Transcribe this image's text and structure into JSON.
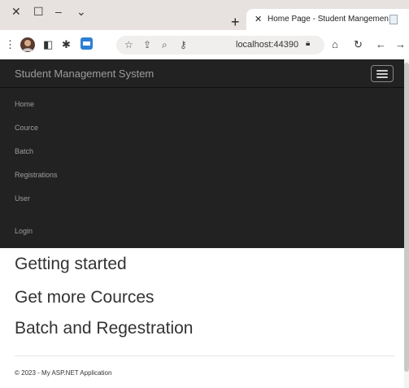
{
  "browser": {
    "tab": {
      "title": "Home Page - Student Mangemen"
    },
    "address": {
      "url": "localhost:44390"
    }
  },
  "navbar": {
    "brand": "Student Management System",
    "items": [
      {
        "label": "Home"
      },
      {
        "label": "Cource"
      },
      {
        "label": "Batch"
      },
      {
        "label": "Registrations"
      },
      {
        "label": "User"
      },
      {
        "label": "Login"
      }
    ]
  },
  "main": {
    "headings": [
      "Getting started",
      "Get more Cources",
      "Batch and Regestration"
    ]
  },
  "footer": {
    "text": "© 2023 - My ASP.NET Application"
  },
  "colors": {
    "navbar_bg": "#222222",
    "navbar_text": "#9d9d9d",
    "body_text": "#333333"
  }
}
